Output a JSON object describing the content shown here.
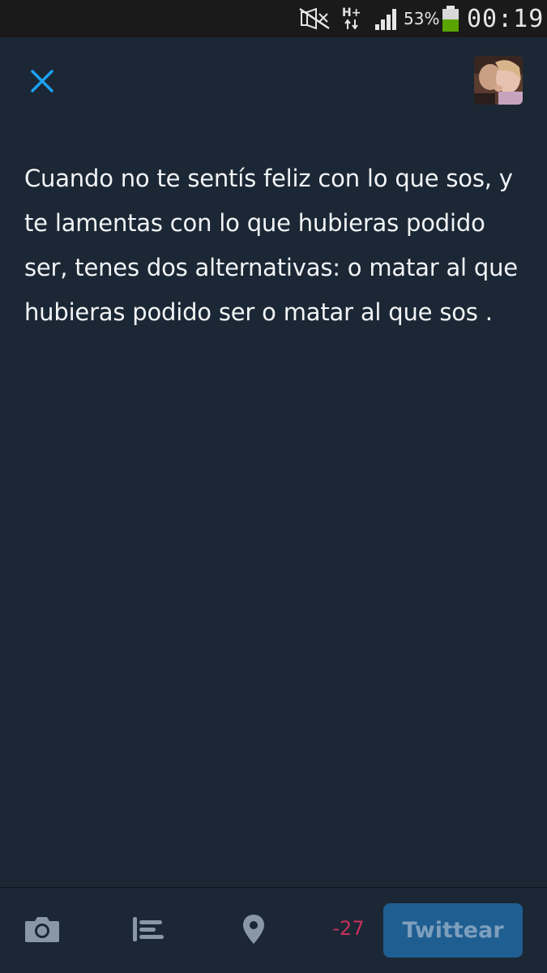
{
  "status_bar": {
    "network_type": "H+",
    "battery_percent": "53%",
    "battery_level": 0.53,
    "time": "00:19",
    "icons": [
      "mute-icon",
      "network-arrows-icon",
      "signal-icon",
      "battery-icon"
    ]
  },
  "compose": {
    "close_icon": "close-icon",
    "avatar": "user-avatar",
    "tweet_text": "Cuando no te sentís feliz con lo que sos, y te lamentas con lo que hubieras podido ser, tenes dos alternativas: o matar al que hubieras podido ser o matar al que sos ."
  },
  "toolbar": {
    "camera_icon": "camera-icon",
    "poll_icon": "poll-icon",
    "location_icon": "location-pin-icon",
    "char_count": "-27",
    "tweet_button_label": "Twittear"
  },
  "colors": {
    "background": "#1b2735",
    "accent": "#1da1f2",
    "counter_negative": "#c8305d",
    "button_disabled_bg": "#1f5e91",
    "icon_gray": "#8a98a6"
  }
}
